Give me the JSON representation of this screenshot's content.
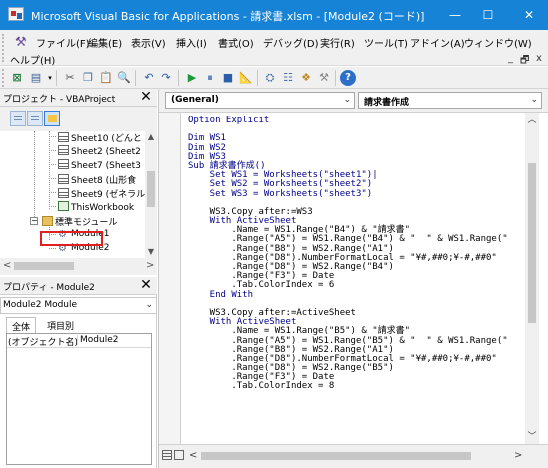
{
  "window": {
    "title": "Microsoft Visual Basic for Applications - 請求書.xlsm - [Module2 (コード)]",
    "minimize": "—",
    "maximize": "☐",
    "close": "✕"
  },
  "menu": {
    "items": [
      "ファイル(F)",
      "編集(E)",
      "表示(V)",
      "挿入(I)",
      "書式(O)",
      "デバッグ(D)",
      "実行(R)",
      "ツール(T)",
      "アドイン(A)",
      "ウィンドウ(W)",
      "ヘルプ(H)"
    ],
    "mdi_minimize": "_",
    "mdi_restore": "🗗",
    "mdi_close": "x"
  },
  "toolbar": {
    "icons": [
      "view-excel-icon",
      "insert-module-icon",
      "cut-icon",
      "copy-icon",
      "paste-icon",
      "find-icon",
      "undo-icon",
      "redo-icon",
      "run-icon",
      "break-icon",
      "reset-icon",
      "design-mode-icon",
      "project-explorer-icon",
      "properties-icon",
      "object-browser-icon",
      "toolbox-icon",
      "help-icon"
    ]
  },
  "project_pane": {
    "title": "プロジェクト - VBAProject",
    "close": "✕",
    "tree": [
      {
        "label": "Sheet10 (どんと",
        "icon": "sheet-icon"
      },
      {
        "label": "Sheet2 (Sheet2",
        "icon": "sheet-icon"
      },
      {
        "label": "Sheet7 (Sheet3",
        "icon": "sheet-icon"
      },
      {
        "label": "Sheet8 (山形食",
        "icon": "sheet-icon"
      },
      {
        "label": "Sheet9 (ゼネラル",
        "icon": "sheet-icon"
      },
      {
        "label": "ThisWorkbook",
        "icon": "workbook-icon"
      },
      {
        "label": "標準モジュール",
        "icon": "folder-icon"
      },
      {
        "label": "Module1",
        "icon": "module-icon"
      },
      {
        "label": "Module2",
        "icon": "module-icon"
      }
    ],
    "toggle_label": "−"
  },
  "properties_pane": {
    "title": "プロパティ - Module2",
    "close": "✕",
    "object_name": "Module2 Module",
    "tabs": [
      "全体",
      "項目別"
    ],
    "rows": [
      {
        "key": "(オブジェクト名)",
        "value": "Module2"
      }
    ]
  },
  "code_window": {
    "object_combo": "(General)",
    "proc_combo": "請求書作成",
    "lines": [
      "Option Explicit",
      "",
      "Dim WS1",
      "Dim WS2",
      "Dim WS3",
      "Sub 請求書作成()",
      "    Set WS1 = Worksheets(\"sheet1\")|",
      "    Set WS2 = Worksheets(\"sheet2\")",
      "    Set WS3 = Worksheets(\"sheet3\")",
      "",
      "    WS3.Copy after:=WS3",
      "    With ActiveSheet",
      "        .Name = WS1.Range(\"B4\") & \"請求書\"",
      "        .Range(\"A5\") = WS1.Range(\"B4\") & \"  \" & WS1.Range(\"",
      "        .Range(\"B8\") = WS2.Range(\"A1\")",
      "        .Range(\"D8\").NumberFormatLocal = \"¥#,##0;¥-#,##0\"",
      "        .Range(\"D8\") = WS2.Range(\"B4\")",
      "        .Range(\"F3\") = Date",
      "        .Tab.ColorIndex = 6",
      "    End With",
      "",
      "    WS3.Copy after:=ActiveSheet",
      "    With ActiveSheet",
      "        .Name = WS1.Range(\"B5\") & \"請求書\"",
      "        .Range(\"A5\") = WS1.Range(\"B5\") & \"  \" & WS1.Range(\"",
      "        .Range(\"B8\") = WS2.Range(\"A1\")",
      "        .Range(\"D8\").NumberFormatLocal = \"¥#,##0;¥-#,##0\"",
      "        .Range(\"D8\") = WS2.Range(\"B5\")",
      "        .Range(\"F3\") = Date",
      "        .Tab.ColorIndex = 8"
    ]
  },
  "colors": {
    "titlebar": "#1783d6",
    "keyword": "#00008b",
    "highlight_box": "#e02020"
  }
}
